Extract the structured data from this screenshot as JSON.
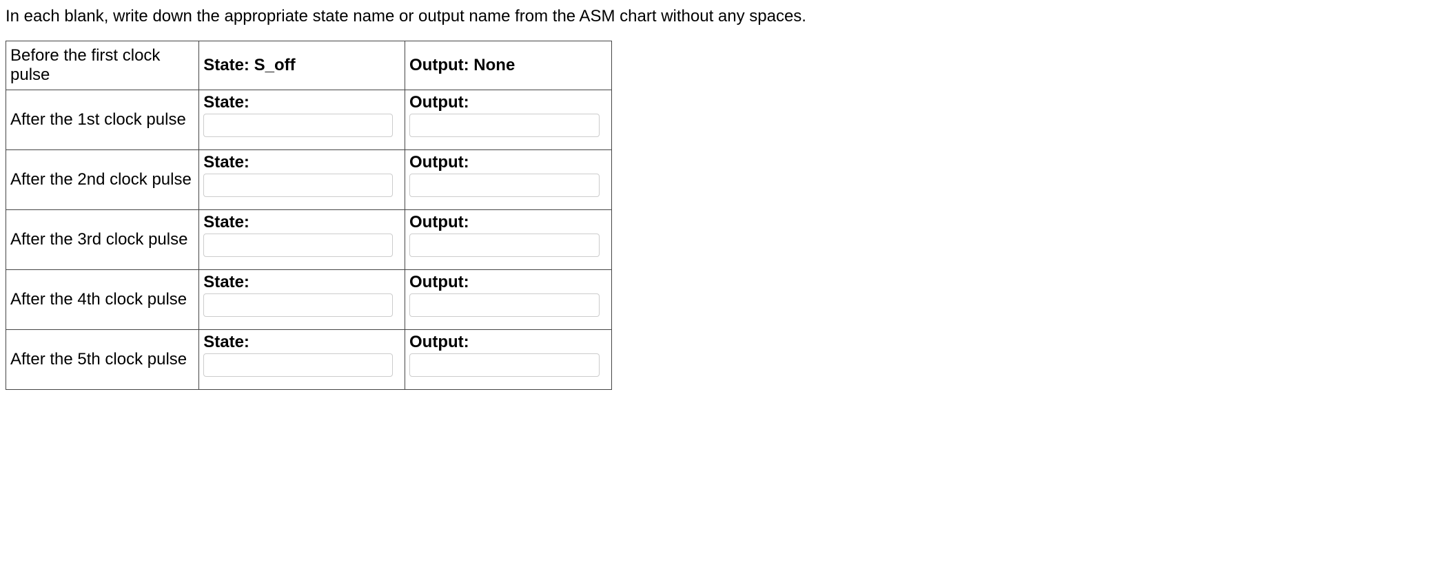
{
  "instruction": "In each blank, write down the appropriate state name or output name from the ASM chart without any spaces.",
  "labels": {
    "state": "State:",
    "output": "Output:"
  },
  "rows": [
    {
      "desc": "Before the first clock pulse",
      "state_value": "S_off",
      "output_value": "None",
      "has_input": false
    },
    {
      "desc": "After the 1st clock pulse",
      "state_value": "",
      "output_value": "",
      "has_input": true
    },
    {
      "desc": "After the 2nd clock pulse",
      "state_value": "",
      "output_value": "",
      "has_input": true
    },
    {
      "desc": "After the 3rd clock pulse",
      "state_value": "",
      "output_value": "",
      "has_input": true
    },
    {
      "desc": "After the 4th clock pulse",
      "state_value": "",
      "output_value": "",
      "has_input": true
    },
    {
      "desc": "After the 5th clock pulse",
      "state_value": "",
      "output_value": "",
      "has_input": true
    }
  ]
}
